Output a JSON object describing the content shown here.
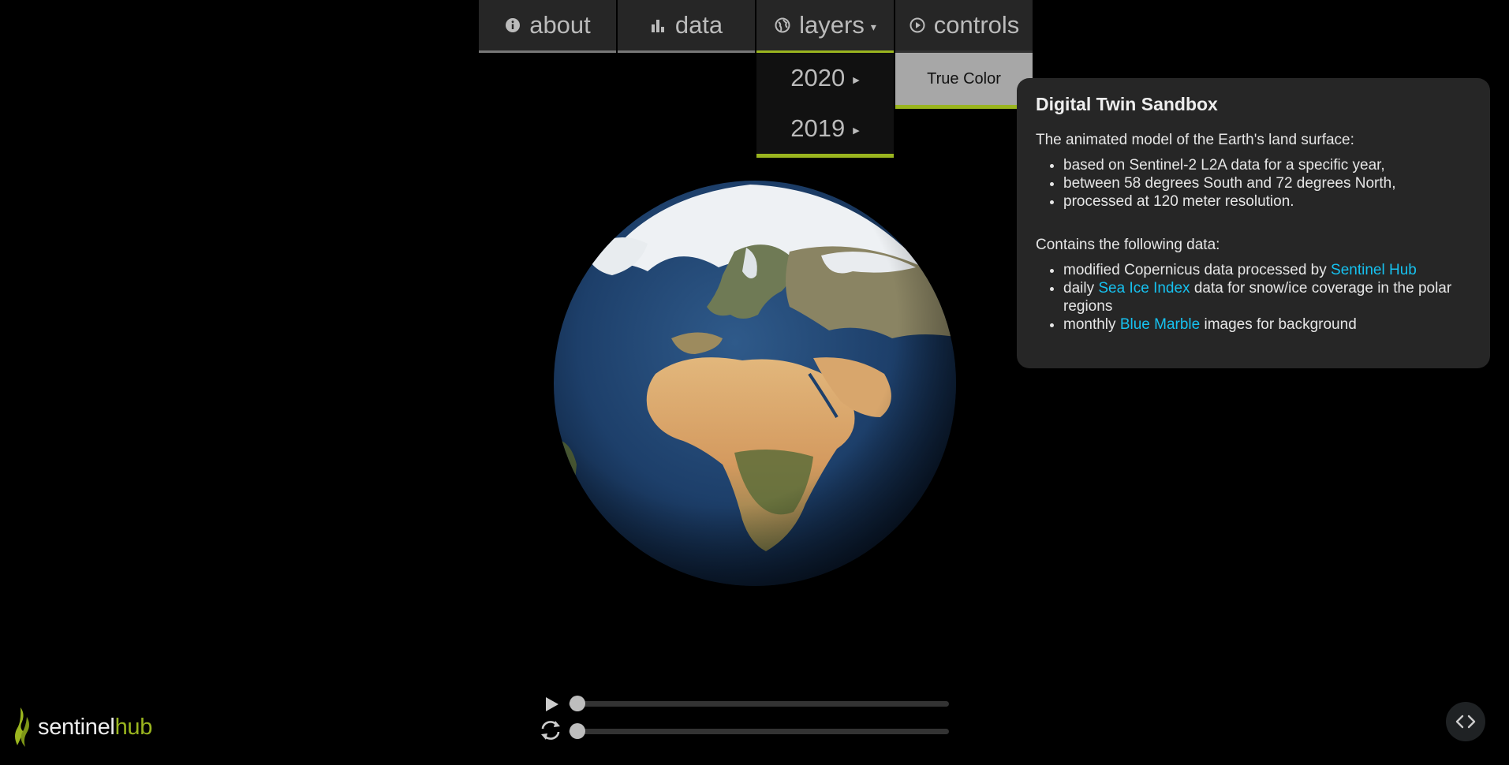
{
  "nav": {
    "tabs": [
      {
        "label": "about",
        "icon": "info-icon"
      },
      {
        "label": "data",
        "icon": "bar-chart-icon"
      },
      {
        "label": "layers",
        "icon": "globe-icon",
        "caret": "▾"
      },
      {
        "label": "controls",
        "icon": "play-circle-icon"
      }
    ]
  },
  "layers_menu": {
    "items": [
      {
        "label": "2020"
      },
      {
        "label": "2019"
      }
    ]
  },
  "submenu": {
    "true_color": "True Color"
  },
  "info": {
    "title": "Digital Twin Sandbox",
    "intro": "The animated model of the Earth's land surface:",
    "bullets": [
      "based on Sentinel-2 L2A data for a specific year,",
      "between 58 degrees South and 72 degrees North,",
      "processed at 120 meter resolution."
    ],
    "contains": "Contains the following data:",
    "data_items": [
      {
        "pre": "modified Copernicus data processed by ",
        "link": "Sentinel Hub",
        "post": ""
      },
      {
        "pre": "daily ",
        "link": "Sea Ice Index",
        "post": " data for snow/ice coverage in the polar regions"
      },
      {
        "pre": "monthly ",
        "link": "Blue Marble",
        "post": " images for background"
      }
    ]
  },
  "playback": {
    "time_progress": 0,
    "rotation_progress": 0
  },
  "logo": {
    "part1": "sentinel",
    "part2": "hub"
  },
  "colors": {
    "accent": "#9ab51f",
    "link": "#16c1ef",
    "panel": "#262626"
  }
}
